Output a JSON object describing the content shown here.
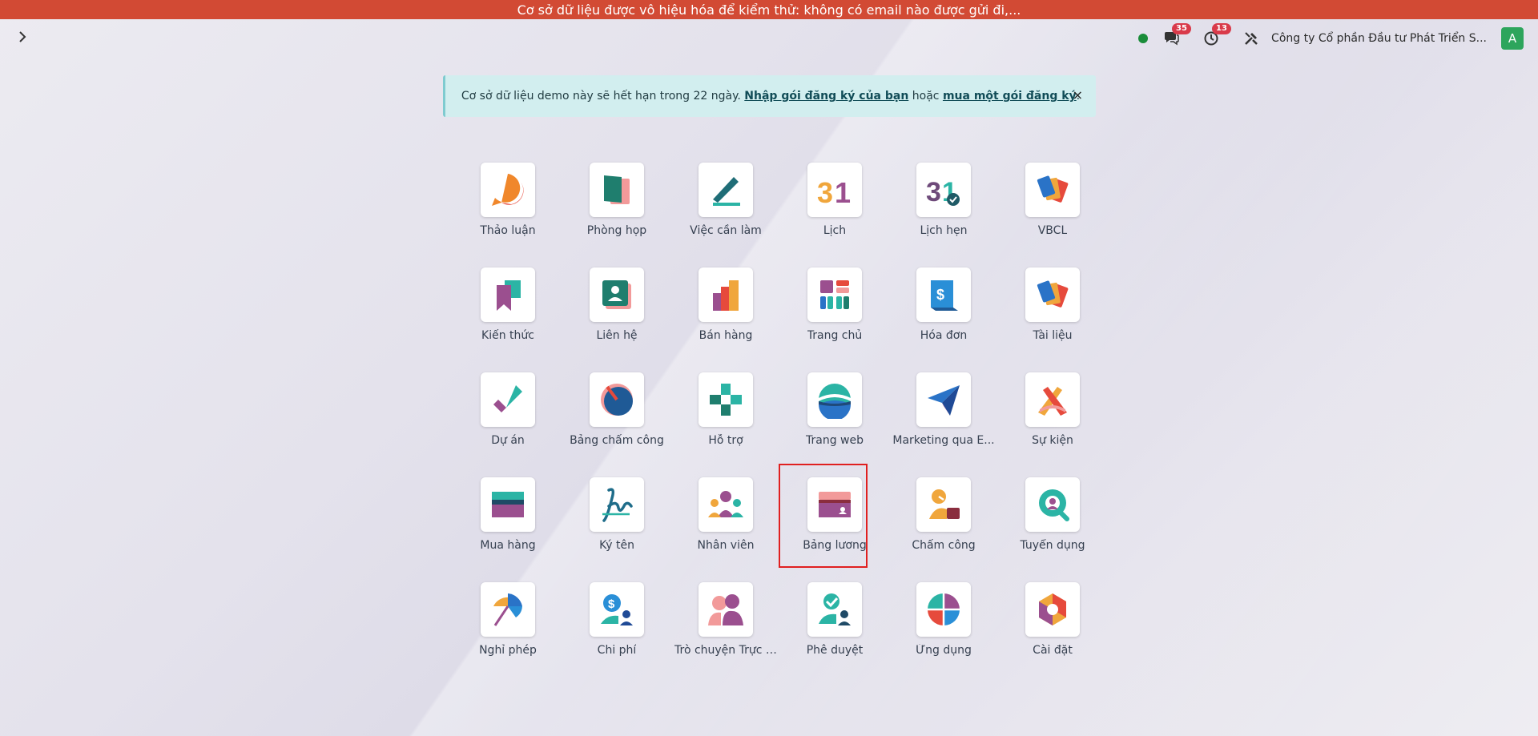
{
  "topbar": {
    "warning": "Cơ sở dữ liệu được vô hiệu hóa để kiểm thử: không có email nào được gửi đi,..."
  },
  "nav": {
    "messages_count": "35",
    "activities_count": "13",
    "company": "Công ty Cổ phần Đầu tư Phát Triển S...",
    "avatar": "A"
  },
  "alert": {
    "text_before": "Cơ sở dữ liệu demo này sẽ hết hạn trong 22 ngày.",
    "link1": "Nhập gói đăng ký của bạn",
    "text_middle": "hoặc",
    "link2": "mua một gói đăng ký",
    "text_after": ".",
    "close": "×"
  },
  "apps": [
    {
      "label": "Thảo luận",
      "icon": "discuss-icon"
    },
    {
      "label": "Phòng họp",
      "icon": "meeting-room-icon"
    },
    {
      "label": "Việc cần làm",
      "icon": "todo-icon"
    },
    {
      "label": "Lịch",
      "icon": "calendar-icon"
    },
    {
      "label": "Lịch hẹn",
      "icon": "appointment-icon"
    },
    {
      "label": "VBCL",
      "icon": "vbcl-icon"
    },
    {
      "label": "Kiến thức",
      "icon": "knowledge-icon"
    },
    {
      "label": "Liên hệ",
      "icon": "contacts-icon"
    },
    {
      "label": "Bán hàng",
      "icon": "sales-icon"
    },
    {
      "label": "Trang chủ",
      "icon": "dashboard-icon"
    },
    {
      "label": "Hóa đơn",
      "icon": "invoice-icon"
    },
    {
      "label": "Tài liệu",
      "icon": "documents-icon"
    },
    {
      "label": "Dự án",
      "icon": "project-icon"
    },
    {
      "label": "Bảng chấm công",
      "icon": "timesheet-icon"
    },
    {
      "label": "Hỗ trợ",
      "icon": "helpdesk-icon"
    },
    {
      "label": "Trang web",
      "icon": "website-icon"
    },
    {
      "label": "Marketing qua E...",
      "icon": "email-marketing-icon"
    },
    {
      "label": "Sự kiện",
      "icon": "events-icon"
    },
    {
      "label": "Mua hàng",
      "icon": "purchase-icon"
    },
    {
      "label": "Ký tên",
      "icon": "sign-icon"
    },
    {
      "label": "Nhân viên",
      "icon": "employees-icon"
    },
    {
      "label": "Bảng lương",
      "icon": "payroll-icon"
    },
    {
      "label": "Chấm công",
      "icon": "attendance-icon"
    },
    {
      "label": "Tuyển dụng",
      "icon": "recruitment-icon"
    },
    {
      "label": "Nghỉ phép",
      "icon": "time-off-icon"
    },
    {
      "label": "Chi phí",
      "icon": "expenses-icon"
    },
    {
      "label": "Trò chuyện Trực ti...",
      "icon": "live-chat-icon"
    },
    {
      "label": "Phê duyệt",
      "icon": "approvals-icon"
    },
    {
      "label": "Ứng dụng",
      "icon": "apps-icon"
    },
    {
      "label": "Cài đặt",
      "icon": "settings-icon"
    }
  ]
}
